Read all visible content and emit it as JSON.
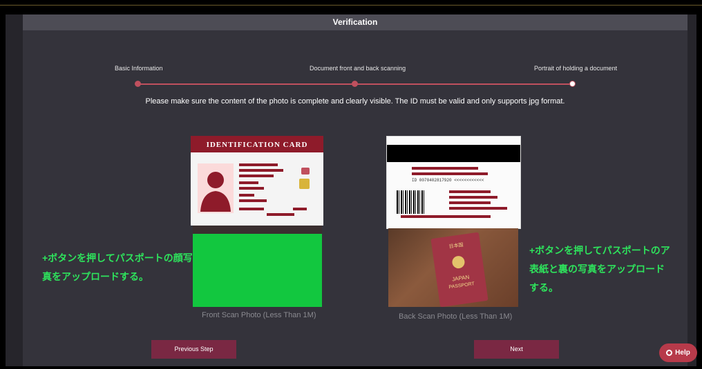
{
  "header": {
    "title": "Verification"
  },
  "steps": [
    {
      "label": "Basic Information"
    },
    {
      "label": "Document front and back scanning"
    },
    {
      "label": "Portrait of holding a document"
    }
  ],
  "instruction": "Please make sure the content of the photo is complete and clearly visible. The ID must be valid and only supports jpg format.",
  "front": {
    "card_title": "IDENTIFICATION CARD",
    "caption": "Front Scan Photo (Less Than 1M)"
  },
  "back": {
    "id_number": "ID 0078402817920 <<<<<<<<<<<<",
    "caption": "Back Scan Photo (Less Than 1M)",
    "passport_country_jp": "日本国",
    "passport_label": "JAPAN",
    "passport_sublabel": "PASSPORT"
  },
  "notes": {
    "left_line1": "+ボタンを押してパスポートの顔写",
    "left_line2": "真をアップロードする。",
    "right_line1": "+ボタンを押してパスポートのア",
    "right_line2": "表紙と裏の写真をアップロード",
    "right_line3": "する。"
  },
  "buttons": {
    "previous": "Previous Step",
    "next": "Next",
    "help": "Help"
  },
  "colors": {
    "accent": "#7a2843",
    "progress": "#c0505e",
    "note_green": "#2ee35c",
    "upload_placeholder": "#12c73f"
  }
}
